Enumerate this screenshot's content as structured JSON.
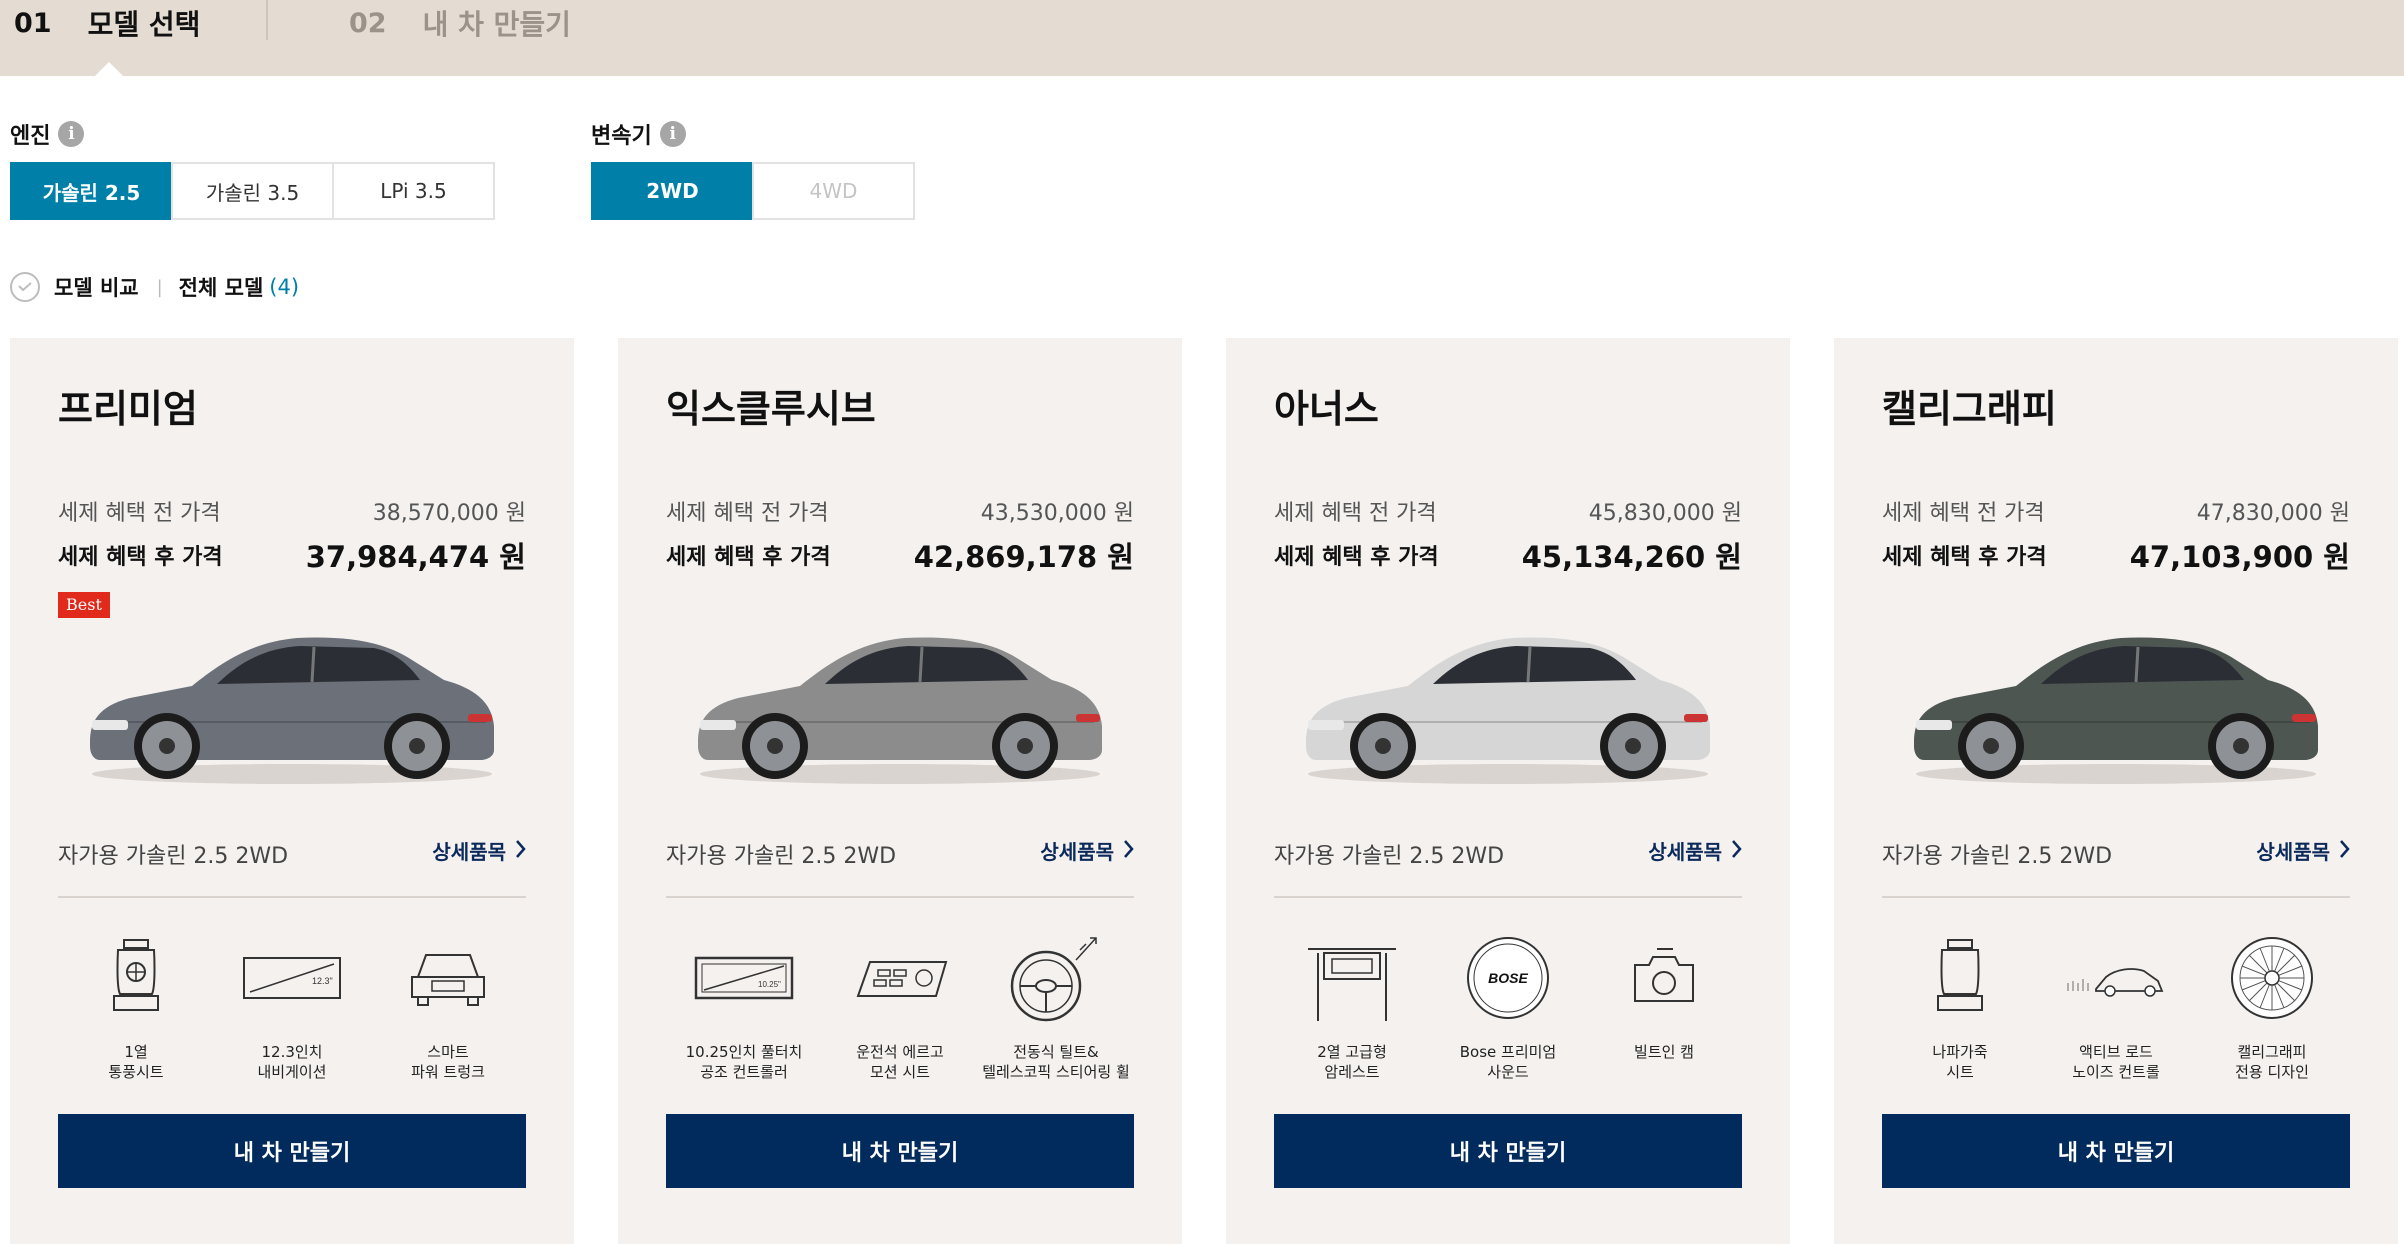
{
  "steps": [
    {
      "num": "01",
      "label": "모델 선택"
    },
    {
      "num": "02",
      "label": "내 차 만들기"
    }
  ],
  "engine": {
    "label": "엔진",
    "options": [
      "가솔린 2.5",
      "가솔린 3.5",
      "LPi 3.5"
    ],
    "selected": "가솔린 2.5"
  },
  "transmission": {
    "label": "변속기",
    "options": [
      "2WD",
      "4WD"
    ],
    "selected": "2WD"
  },
  "compare": {
    "label": "모델 비교",
    "all_label": "전체 모델",
    "count": "(4)"
  },
  "cards": [
    {
      "model": "프리미엄",
      "price_before_label": "세제 혜택 전 가격",
      "price_before": "38,570,000 원",
      "price_after_label": "세제 혜택 후 가격",
      "price_after": "37,984,474 원",
      "badge": "Best",
      "car_color": "#6b7079",
      "spec": "자가용 가솔린 2.5 2WD",
      "detail_label": "상세품목",
      "features": [
        {
          "icon": "ventilated-seat-icon",
          "text": "1열\n통풍시트"
        },
        {
          "icon": "navigation-screen-icon",
          "text": "12.3인치\n내비게이션"
        },
        {
          "icon": "power-trunk-icon",
          "text": "스마트\n파워 트렁크"
        }
      ],
      "button_label": "내 차 만들기"
    },
    {
      "model": "익스클루시브",
      "price_before_label": "세제 혜택 전 가격",
      "price_before": "43,530,000 원",
      "price_after_label": "세제 혜택 후 가격",
      "price_after": "42,869,178 원",
      "badge": "",
      "car_color": "#8c8c8c",
      "spec": "자가용 가솔린 2.5 2WD",
      "detail_label": "상세품목",
      "features": [
        {
          "icon": "climate-controller-icon",
          "text": "10.25인치 풀터치\n공조 컨트롤러"
        },
        {
          "icon": "ergo-seat-icon",
          "text": "운전석 에르고\n모션 시트"
        },
        {
          "icon": "steering-wheel-icon",
          "text": "전동식 틸트&\n텔레스코픽 스티어링 휠"
        }
      ],
      "button_label": "내 차 만들기"
    },
    {
      "model": "아너스",
      "price_before_label": "세제 혜택 전 가격",
      "price_before": "45,830,000 원",
      "price_after_label": "세제 혜택 후 가격",
      "price_after": "45,134,260 원",
      "badge": "",
      "car_color": "#d6d6d6",
      "spec": "자가용 가솔린 2.5 2WD",
      "detail_label": "상세품목",
      "features": [
        {
          "icon": "armrest-icon",
          "text": "2열 고급형\n암레스트"
        },
        {
          "icon": "bose-speaker-icon",
          "text": "Bose 프리미엄\n사운드",
          "logo": "BOSE"
        },
        {
          "icon": "builtin-cam-icon",
          "text": "빌트인 캠"
        }
      ],
      "button_label": "내 차 만들기"
    },
    {
      "model": "캘리그래피",
      "price_before_label": "세제 혜택 전 가격",
      "price_before": "47,830,000 원",
      "price_after_label": "세제 혜택 후 가격",
      "price_after": "47,103,900 원",
      "badge": "",
      "car_color": "#4e5652",
      "spec": "자가용 가솔린 2.5 2WD",
      "detail_label": "상세품목",
      "features": [
        {
          "icon": "nappa-seat-icon",
          "text": "나파가죽\n시트"
        },
        {
          "icon": "road-noise-control-icon",
          "text": "액티브 로드\n노이즈 컨트롤"
        },
        {
          "icon": "calligraphy-wheel-icon",
          "text": "캘리그래피\n전용 디자인"
        }
      ],
      "button_label": "내 차 만들기"
    }
  ]
}
